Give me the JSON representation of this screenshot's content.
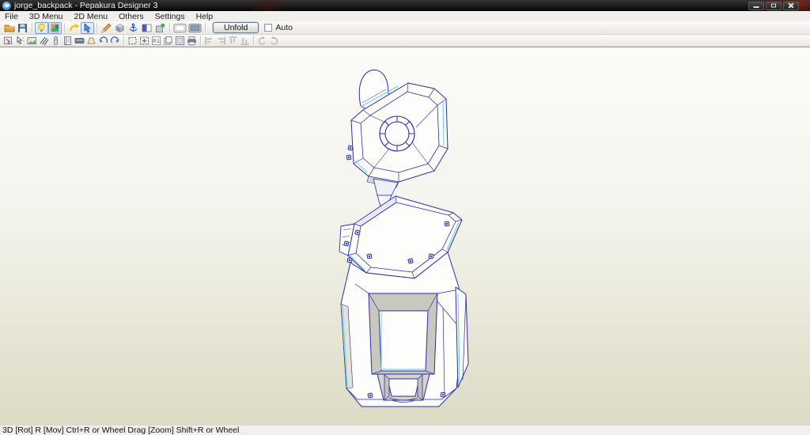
{
  "window": {
    "title": "jorge_backpack - Pepakura Designer 3",
    "controls": {
      "minimize": "minimize",
      "restore": "restore",
      "close": "close"
    }
  },
  "menubar": {
    "items": [
      "File",
      "3D Menu",
      "2D Menu",
      "Others",
      "Settings",
      "Help"
    ]
  },
  "toolbar1": {
    "icons": [
      "open-folder",
      "save",
      "light-toggle",
      "texture-view",
      "rotate-view",
      "select-pointer",
      "pencil-edit",
      "material-box",
      "anchor-fix",
      "split-view",
      "part-settings",
      "pane-3d",
      "pane-2d"
    ],
    "pressed_icons": [
      "light-toggle",
      "texture-view",
      "select-pointer",
      "pane-2d"
    ],
    "unfold_label": "Unfold",
    "auto_label": "Auto",
    "auto_checked": false
  },
  "toolbar2": {
    "icons": [
      "select-part",
      "pick-point",
      "edit-image",
      "hatch-lines",
      "glue-stick",
      "notebook",
      "envelope-slot",
      "flap-tab",
      "undo-curve",
      "redo-curve",
      "marquee-box",
      "move-marquee",
      "page-number",
      "page-stack",
      "page-frame",
      "printer",
      "align-left",
      "align-right",
      "align-top",
      "align-bottom",
      "rotate-ccw",
      "rotate-cw"
    ],
    "disabled_icons": [
      "align-left",
      "align-right",
      "align-top",
      "align-bottom",
      "rotate-ccw",
      "rotate-cw"
    ],
    "page_icon_label": "P.1"
  },
  "canvas": {
    "model": "jorge_backpack 3D wireframe",
    "colors": {
      "outline": "#2d2da6",
      "accent_cyan": "#5fd2d8",
      "accent_violet": "#8f7bd8",
      "face": "#fdfdfb",
      "shade": "#c8c8be",
      "background_top": "#fbfbf8",
      "background_bottom": "#dcdbc5"
    }
  },
  "statusbar": {
    "text": "3D [Rot] R [Mov] Ctrl+R or Wheel Drag [Zoom] Shift+R or Wheel"
  }
}
